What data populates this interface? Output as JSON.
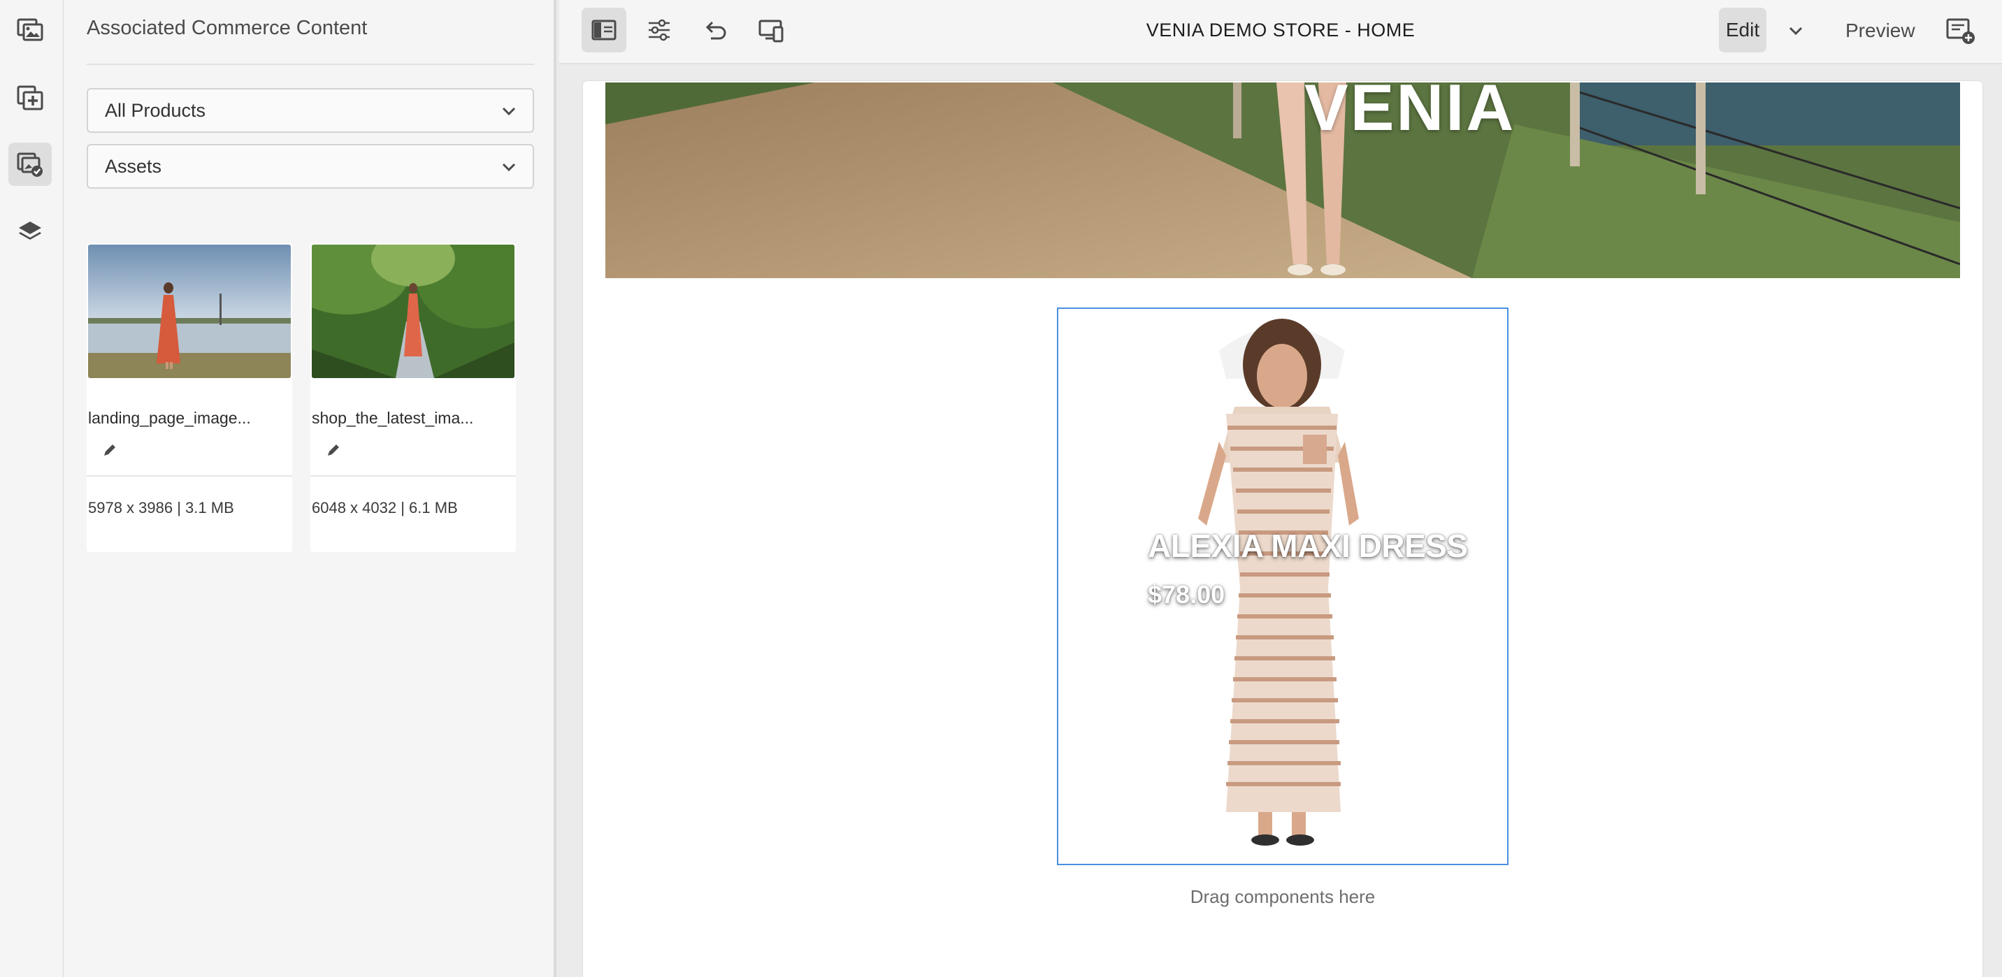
{
  "rail": {
    "items": [
      {
        "name": "assets-panel",
        "active": false
      },
      {
        "name": "components-panel",
        "active": false
      },
      {
        "name": "commerce-content-panel",
        "active": true
      },
      {
        "name": "content-tree-panel",
        "active": false
      }
    ]
  },
  "panel": {
    "title": "Associated Commerce Content",
    "filter_select": "All Products",
    "type_select": "Assets",
    "assets": [
      {
        "name": "landing_page_image...",
        "meta": "5978 x 3986 | 3.1 MB"
      },
      {
        "name": "shop_the_latest_ima...",
        "meta": "6048 x 4032 | 6.1 MB"
      }
    ]
  },
  "toolbar": {
    "page_title": "VENIA DEMO STORE - HOME",
    "mode_label": "Edit",
    "preview_label": "Preview"
  },
  "canvas": {
    "hero_word": "VENIA",
    "product": {
      "name": "ALEXIA MAXI DRESS",
      "price": "$78.00"
    },
    "drag_hint": "Drag components here"
  },
  "colors": {
    "selection_border": "#4a8fe0",
    "panel_bg": "#f5f5f5",
    "active_btn_bg": "#dedede"
  }
}
